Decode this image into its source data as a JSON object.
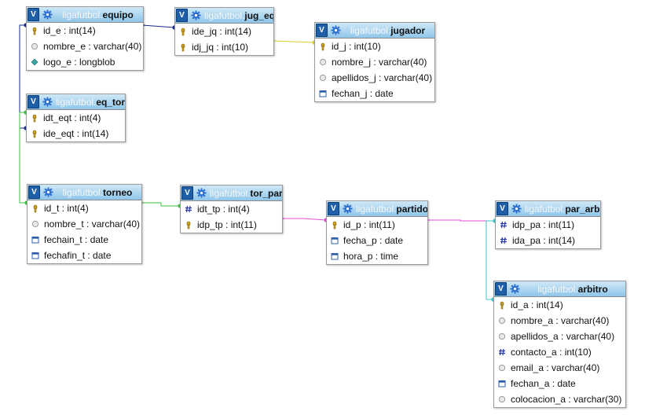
{
  "db_prefix": "ligafutbol.",
  "colors": {
    "header_top": "#cfe8f7",
    "header_bottom": "#8fc6ea",
    "link_blue": "#1a2a8c",
    "link_yellow": "#d8cf2a",
    "link_green": "#3cbf3c",
    "link_magenta": "#e04fd8",
    "link_cyan": "#3cc6c6"
  },
  "tables": [
    {
      "key": "equipo",
      "name": "equipo",
      "columns": [
        {
          "icon": "key-icon",
          "text": "id_e : int(14)"
        },
        {
          "icon": "column-icon",
          "text": "nombre_e : varchar(40)"
        },
        {
          "icon": "blob-icon",
          "text": "logo_e : longblob"
        }
      ]
    },
    {
      "key": "jug_eq",
      "name": "jug_eq",
      "columns": [
        {
          "icon": "key-icon",
          "text": "ide_jq : int(14)"
        },
        {
          "icon": "key-icon",
          "text": "idj_jq : int(10)"
        }
      ]
    },
    {
      "key": "jugador",
      "name": "jugador",
      "columns": [
        {
          "icon": "key-icon",
          "text": "id_j : int(10)"
        },
        {
          "icon": "column-icon",
          "text": "nombre_j : varchar(40)"
        },
        {
          "icon": "column-icon",
          "text": "apellidos_j : varchar(40)"
        },
        {
          "icon": "date-icon",
          "text": "fechan_j : date"
        }
      ]
    },
    {
      "key": "eq_tor",
      "name": "eq_tor",
      "columns": [
        {
          "icon": "key-icon",
          "text": "idt_eqt : int(4)"
        },
        {
          "icon": "key-icon",
          "text": "ide_eqt : int(14)"
        }
      ]
    },
    {
      "key": "torneo",
      "name": "torneo",
      "columns": [
        {
          "icon": "key-icon",
          "text": "id_t : int(4)"
        },
        {
          "icon": "column-icon",
          "text": "nombre_t : varchar(40)"
        },
        {
          "icon": "date-icon",
          "text": "fechain_t : date"
        },
        {
          "icon": "date-icon",
          "text": "fechafin_t : date"
        }
      ]
    },
    {
      "key": "tor_par",
      "name": "tor_par",
      "columns": [
        {
          "icon": "hash-icon",
          "text": "idt_tp : int(4)"
        },
        {
          "icon": "key-icon",
          "text": "idp_tp : int(11)"
        }
      ]
    },
    {
      "key": "partido",
      "name": "partido",
      "columns": [
        {
          "icon": "key-icon",
          "text": "id_p : int(11)"
        },
        {
          "icon": "date-icon",
          "text": "fecha_p : date"
        },
        {
          "icon": "date-icon",
          "text": "hora_p : time"
        }
      ]
    },
    {
      "key": "par_arb",
      "name": "par_arb",
      "columns": [
        {
          "icon": "hash-icon",
          "text": "idp_pa : int(11)"
        },
        {
          "icon": "hash-icon",
          "text": "ida_pa : int(14)"
        }
      ]
    },
    {
      "key": "arbitro",
      "name": "arbitro",
      "columns": [
        {
          "icon": "key-icon",
          "text": "id_a : int(14)"
        },
        {
          "icon": "column-icon",
          "text": "nombre_a : varchar(40)"
        },
        {
          "icon": "column-icon",
          "text": "apellidos_a : varchar(40)"
        },
        {
          "icon": "hash-icon",
          "text": "contacto_a : int(10)"
        },
        {
          "icon": "column-icon",
          "text": "email_a : varchar(40)"
        },
        {
          "icon": "date-icon",
          "text": "fechan_a : date"
        },
        {
          "icon": "column-icon",
          "text": "colocacion_a : varchar(30)"
        }
      ]
    }
  ],
  "relations": [
    {
      "from": "equipo",
      "to": "jug_eq",
      "color": "#1a2a8c"
    },
    {
      "from": "jug_eq",
      "to": "jugador",
      "color": "#d8cf2a"
    },
    {
      "from": "equipo",
      "to": "eq_tor",
      "color": "#1a2a8c"
    },
    {
      "from": "torneo",
      "to": "eq_tor",
      "color": "#3cbf3c"
    },
    {
      "from": "torneo",
      "to": "tor_par",
      "color": "#3cbf3c"
    },
    {
      "from": "tor_par",
      "to": "partido",
      "color": "#e04fd8"
    },
    {
      "from": "partido",
      "to": "par_arb",
      "color": "#e04fd8"
    },
    {
      "from": "par_arb",
      "to": "arbitro",
      "color": "#3cc6c6"
    }
  ]
}
